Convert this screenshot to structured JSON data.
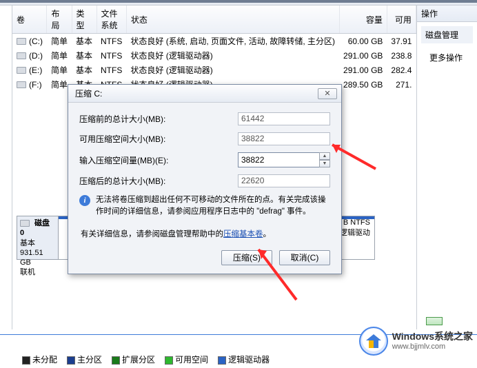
{
  "toolbar": {},
  "table": {
    "headers": {
      "vol": "卷",
      "layout": "布局",
      "type": "类型",
      "fs": "文件系统",
      "status": "状态",
      "capacity": "容量",
      "free": "可用"
    },
    "rows": [
      {
        "vol": "(C:)",
        "layout": "简单",
        "type": "基本",
        "fs": "NTFS",
        "status": "状态良好 (系统, 启动, 页面文件, 活动, 故障转储, 主分区)",
        "capacity": "60.00 GB",
        "free": "37.91"
      },
      {
        "vol": "(D:)",
        "layout": "简单",
        "type": "基本",
        "fs": "NTFS",
        "status": "状态良好 (逻辑驱动器)",
        "capacity": "291.00 GB",
        "free": "238.8"
      },
      {
        "vol": "(E:)",
        "layout": "简单",
        "type": "基本",
        "fs": "NTFS",
        "status": "状态良好 (逻辑驱动器)",
        "capacity": "291.00 GB",
        "free": "282.4"
      },
      {
        "vol": "(F:)",
        "layout": "简单",
        "type": "基本",
        "fs": "NTFS",
        "status": "状态良好 (逻辑驱动器)",
        "capacity": "289.50 GB",
        "free": "271."
      }
    ]
  },
  "right": {
    "header": "操作",
    "task": "磁盘管理",
    "more": "更多操作"
  },
  "disk": {
    "label": "磁盘 0",
    "type": "基本",
    "size": "931.51 GB",
    "status": "联机",
    "part_fs": "B NTFS",
    "part_kind": "逻辑驱动"
  },
  "legend": {
    "unalloc": "未分配",
    "primary": "主分区",
    "ext": "扩展分区",
    "free": "可用空间",
    "logical": "逻辑驱动器"
  },
  "dialog": {
    "title": "压缩 C:",
    "row_total_before": "压缩前的总计大小(MB):",
    "val_total_before": "61442",
    "row_avail": "可用压缩空间大小(MB):",
    "val_avail": "38822",
    "row_input": "输入压缩空间量(MB)(E):",
    "val_input": "38822",
    "row_total_after": "压缩后的总计大小(MB):",
    "val_total_after": "22620",
    "info_text_a": "无法将卷压缩到超出任何不可移动的文件所在的点。有关完成该操作时间的详细信息，请参阅应用程序日志中的 \"defrag\" 事件。",
    "detail_prefix": "有关详细信息，请参阅磁盘管理帮助中的",
    "detail_link": "压缩基本卷",
    "detail_suffix": "。",
    "btn_shrink": "压缩(S)",
    "btn_cancel": "取消(C)"
  },
  "watermark": {
    "brand": "Windows系统之家",
    "url": "www.bjjmlv.com"
  }
}
